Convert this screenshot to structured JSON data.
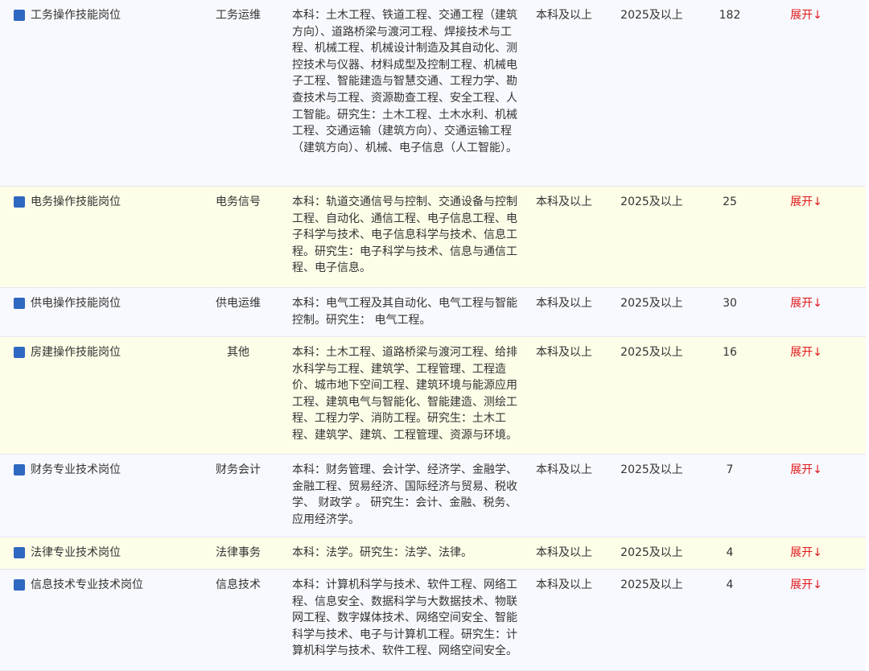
{
  "toggle_label": "展开↓",
  "colors": {
    "square": "#2e68c0",
    "row_odd": "#f8f9fe",
    "row_even": "#fefde8",
    "toggle": "#e0181b"
  },
  "rows": [
    {
      "name": "工务操作技能岗位",
      "category": "工务运维",
      "major": "本科：土木工程、铁道工程、交通工程（建筑方向）、道路桥梁与渡河工程、焊接技术与工程、机械工程、机械设计制造及其自动化、测控技术与仪器、材料成型及控制工程、机械电子工程、智能建造与智慧交通、工程力学、勘查技术与工程、资源勘查工程、安全工程、人工智能。研究生：土木工程、土木水利、机械工程、交通运输（建筑方向）、交通运输工程（建筑方向）、机械、电子信息（人工智能）。",
      "education": "本科及以上",
      "year": "2025及以上",
      "count": "182"
    },
    {
      "name": "电务操作技能岗位",
      "category": "电务信号",
      "major": "本科：轨道交通信号与控制、交通设备与控制工程、自动化、通信工程、电子信息工程、电子科学与技术、电子信息科学与技术、信息工程。研究生：电子科学与技术、信息与通信工程、电子信息。",
      "education": "本科及以上",
      "year": "2025及以上",
      "count": "25"
    },
    {
      "name": "供电操作技能岗位",
      "category": "供电运维",
      "major": "本科：电气工程及其自动化、电气工程与智能控制。研究生： 电气工程。",
      "education": "本科及以上",
      "year": "2025及以上",
      "count": "30"
    },
    {
      "name": "房建操作技能岗位",
      "category": "其他",
      "major": "本科：土木工程、道路桥梁与渡河工程、给排水科学与工程、建筑学、工程管理、工程造价、城市地下空间工程、建筑环境与能源应用工程、建筑电气与智能化、智能建造、测绘工程、工程力学、消防工程。研究生：土木工程、建筑学、建筑、工程管理、资源与环境。",
      "education": "本科及以上",
      "year": "2025及以上",
      "count": "16"
    },
    {
      "name": "财务专业技术岗位",
      "category": "财务会计",
      "major": "本科：财务管理、会计学、经济学、金融学、金融工程、贸易经济、国际经济与贸易、税收学、 财政学 。 研究生：会计、金融、税务、应用经济学。",
      "education": "本科及以上",
      "year": "2025及以上",
      "count": "7"
    },
    {
      "name": "法律专业技术岗位",
      "category": "法律事务",
      "major": "本科：法学。研究生：法学、法律。",
      "education": "本科及以上",
      "year": "2025及以上",
      "count": "4"
    },
    {
      "name": "信息技术专业技术岗位",
      "category": "信息技术",
      "major": "本科：计算机科学与技术、软件工程、网络工程、信息安全、数据科学与大数据技术、物联网工程、数字媒体技术、网络空间安全、智能科学与技术、电子与计算机工程。研究生：计算机科学与技术、软件工程、网络空间安全。",
      "education": "本科及以上",
      "year": "2025及以上",
      "count": "4"
    }
  ]
}
